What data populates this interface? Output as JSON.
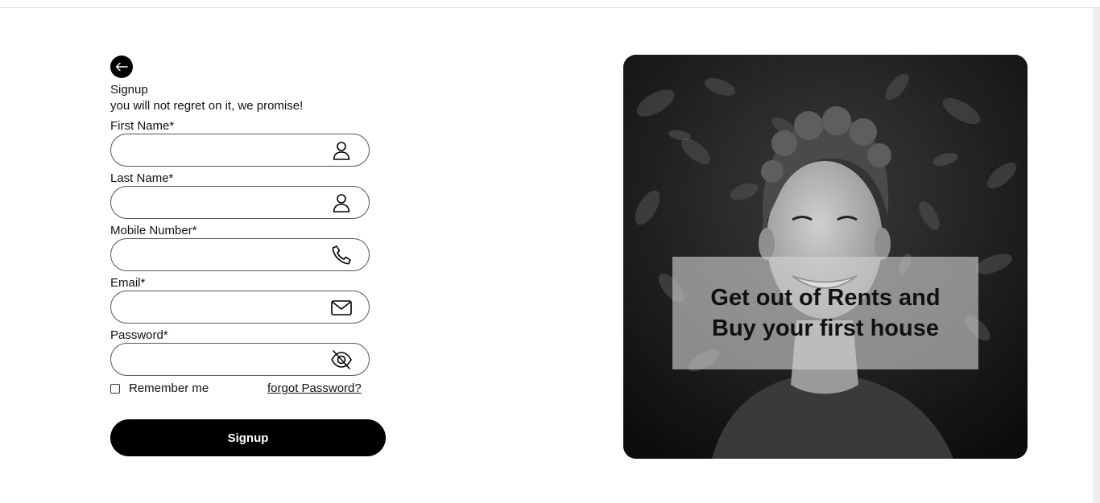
{
  "header": {
    "back_icon": "arrow-left-icon",
    "title": "Signup",
    "subtitle": "you will not regret on it, we promise!"
  },
  "form": {
    "fields": [
      {
        "label": "First Name*",
        "value": "",
        "icon": "user-icon"
      },
      {
        "label": "Last Name*",
        "value": "",
        "icon": "user-icon"
      },
      {
        "label": "Mobile Number*",
        "value": "",
        "icon": "phone-icon"
      },
      {
        "label": "Email*",
        "value": "",
        "icon": "mail-icon"
      },
      {
        "label": "Password*",
        "value": "",
        "icon": "eye-off-icon"
      }
    ],
    "remember_label": "Remember me",
    "remember_checked": false,
    "forgot_label": "forgot Password?",
    "submit_label": "Signup"
  },
  "hero": {
    "caption": "Get out of Rents and Buy your first house"
  },
  "colors": {
    "primary": "#000000",
    "background": "#ffffff",
    "border": "#555555"
  }
}
